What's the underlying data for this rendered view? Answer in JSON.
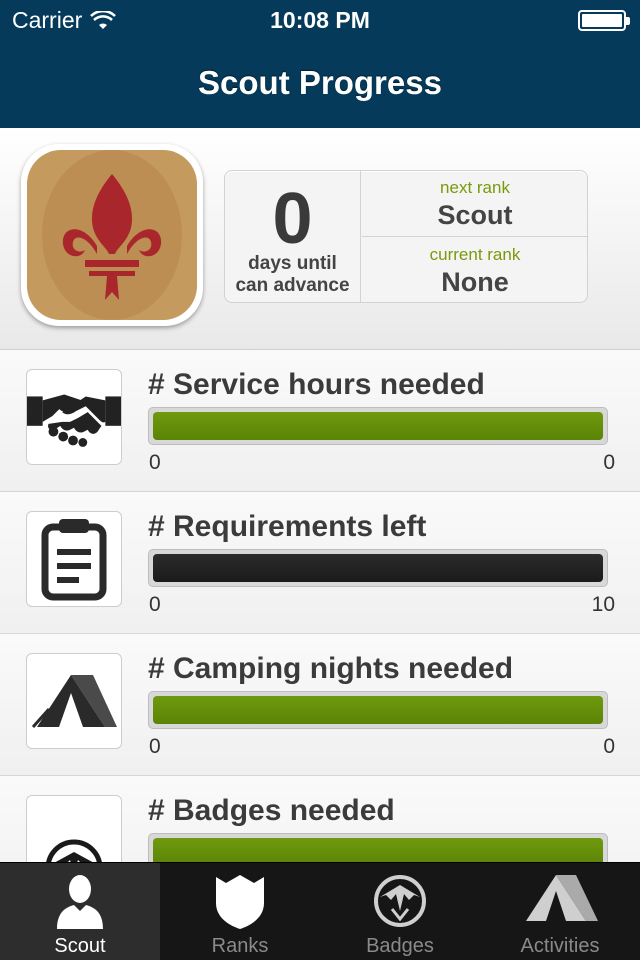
{
  "status_bar": {
    "carrier": "Carrier",
    "time": "10:08 PM"
  },
  "nav": {
    "title": "Scout Progress"
  },
  "summary": {
    "days_value": "0",
    "days_label_line1": "days until",
    "days_label_line2": "can advance",
    "next_rank_caption": "next rank",
    "next_rank": "Scout",
    "current_rank_caption": "current rank",
    "current_rank": "None"
  },
  "progress_rows": [
    {
      "title": "# Service hours needed",
      "min": "0",
      "max": "0",
      "icon": "handshake-icon"
    },
    {
      "title": "# Requirements left",
      "min": "0",
      "max": "10",
      "icon": "clipboard-icon"
    },
    {
      "title": "# Camping nights needed",
      "min": "0",
      "max": "0",
      "icon": "tent-icon"
    },
    {
      "title": "# Badges needed",
      "min": "",
      "max": "",
      "icon": "eagle-icon"
    }
  ],
  "tabs": [
    {
      "label": "Scout",
      "icon": "person-icon",
      "active": true
    },
    {
      "label": "Ranks",
      "icon": "shield-icon",
      "active": false
    },
    {
      "label": "Badges",
      "icon": "eagle-icon",
      "active": false
    },
    {
      "label": "Activities",
      "icon": "tent-icon",
      "active": false
    }
  ],
  "colors": {
    "navbar": "#053a5a",
    "accent_green": "#7a9a0c",
    "bar_green": "#6f9a0e",
    "fleur": "#a9262c",
    "badge_tan": "#c59a5f"
  }
}
